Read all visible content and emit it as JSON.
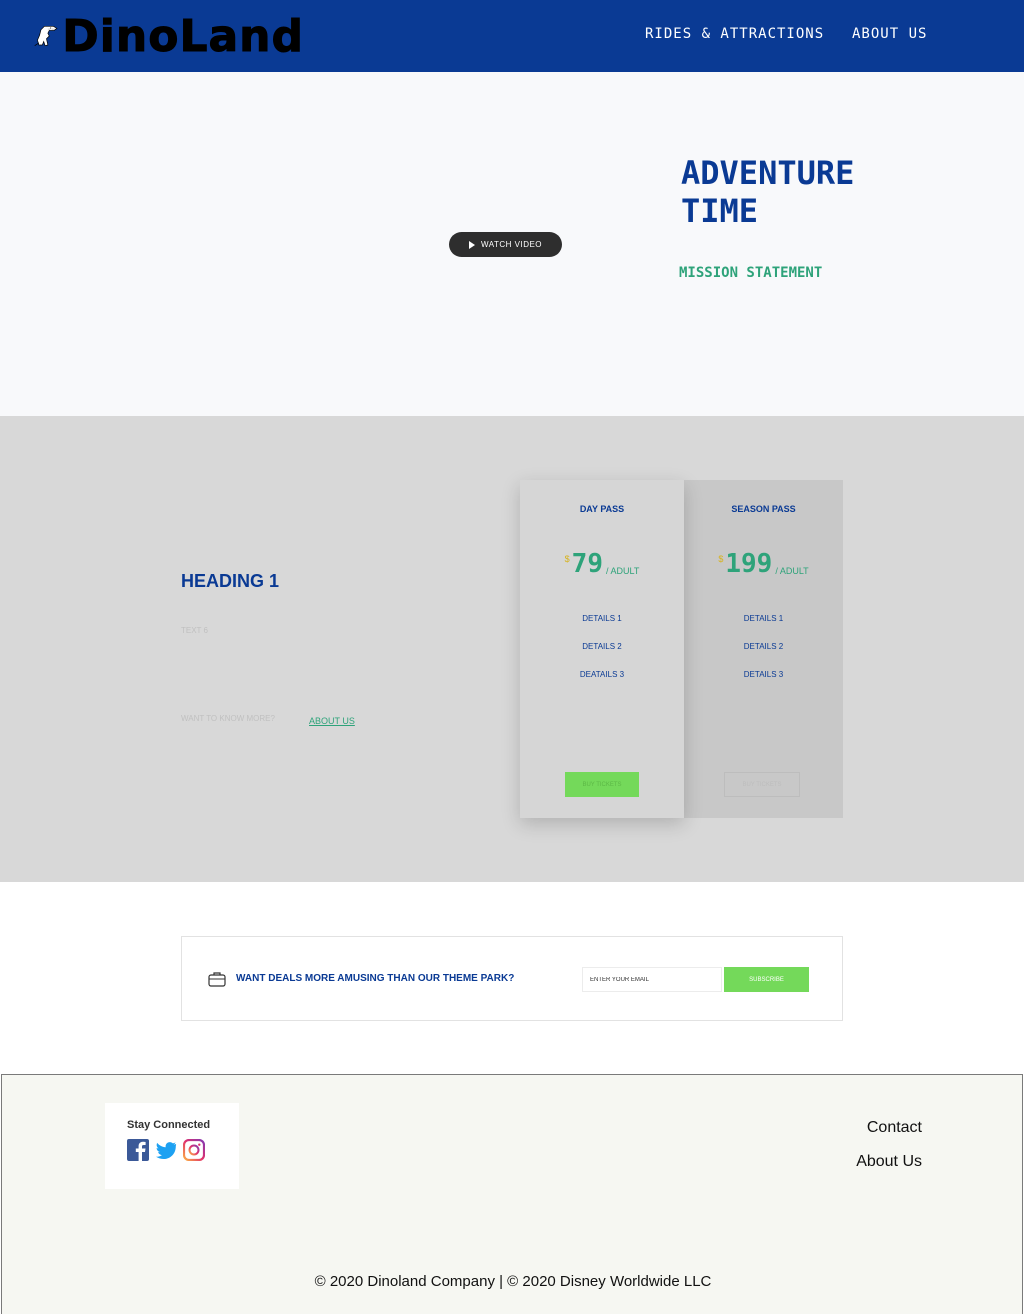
{
  "header": {
    "logo_text": "DinoLand",
    "nav": {
      "rides_label": "Rides & Attractions",
      "about_label": "About Us"
    }
  },
  "hero": {
    "watch_video_label": "WATCH VIDEO",
    "title": "Adventure Time",
    "subtitle": "Mission Statement"
  },
  "pricing": {
    "heading": "Heading 1",
    "text": "Text 6",
    "want_more": "Want to know more?",
    "about_link": "About Us",
    "cards": [
      {
        "title": "Day Pass",
        "currency": "$",
        "price": "79",
        "per": "/ Adult",
        "details": [
          "Details 1",
          "Details 2",
          "Deatails 3"
        ],
        "button_label": "Buy Tickets"
      },
      {
        "title": "Season Pass",
        "currency": "$",
        "price": "199",
        "per": "/ Adult",
        "details": [
          "Details 1",
          "Details 2",
          "Details 3"
        ],
        "button_label": "Buy Tickets"
      }
    ]
  },
  "newsletter": {
    "text": "Want deals more amusing than our theme park?",
    "email_placeholder": "Enter your email",
    "subscribe_label": "Subscribe"
  },
  "footer": {
    "stay_connected": "Stay Connected",
    "contact_label": "Contact",
    "about_label": "About Us",
    "copyright": "© 2020 Dinoland  Company | © 2020 Disney Worldwide LLC"
  },
  "colors": {
    "brand_blue": "#0a3a94",
    "accent_green": "#2ea37a",
    "button_green": "#74d95a",
    "price_gold": "#d7b21a"
  }
}
